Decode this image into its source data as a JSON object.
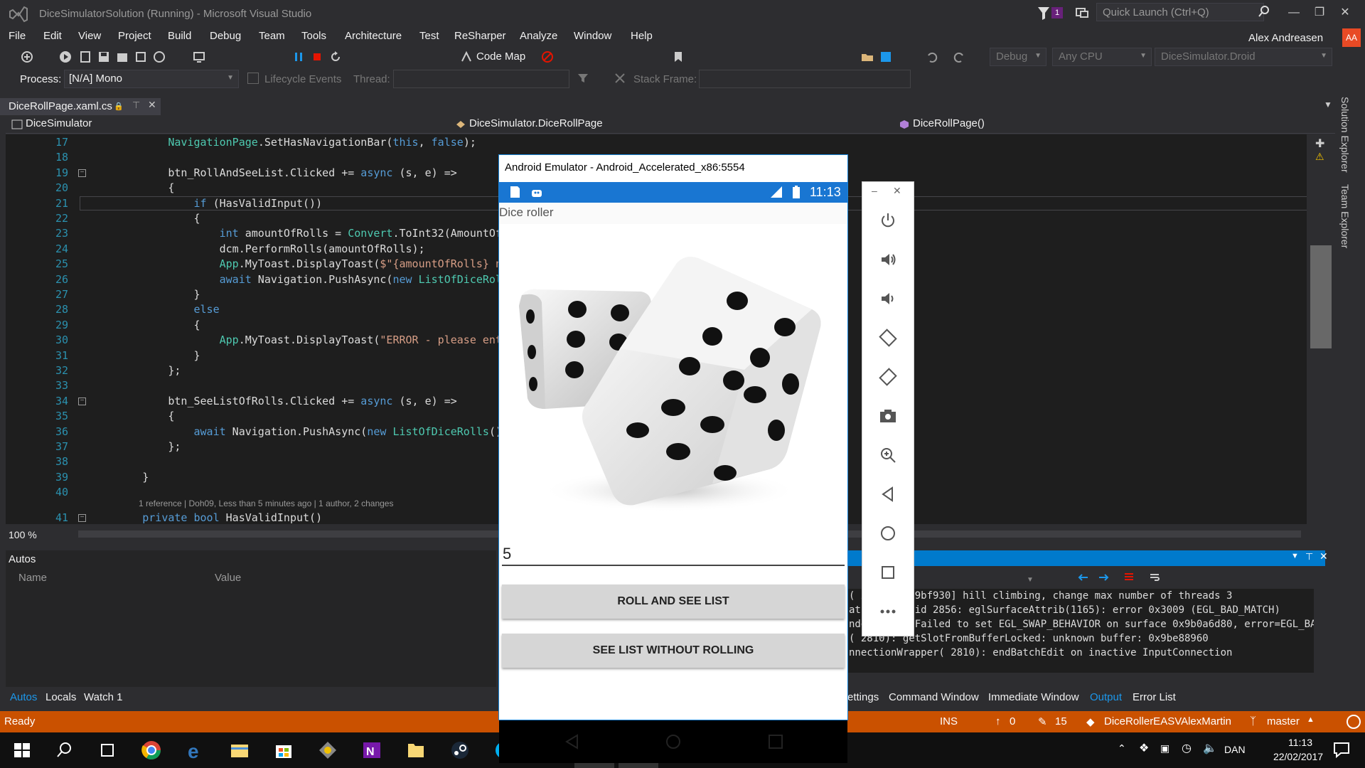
{
  "window": {
    "title": "DiceSimulatorSolution (Running) - Microsoft Visual Studio",
    "notification_count": "1",
    "quick_launch_placeholder": "Quick Launch (Ctrl+Q)",
    "user": "Alex Andreasen",
    "user_initials": "AA"
  },
  "menu": [
    "File",
    "Edit",
    "View",
    "Project",
    "Build",
    "Debug",
    "Team",
    "Tools",
    "Architecture",
    "Test",
    "ReSharper",
    "Analyze",
    "Window",
    "Help"
  ],
  "toolbar": {
    "code_map": "Code Map",
    "config": "Debug",
    "platform": "Any CPU",
    "startup_project": "DiceSimulator.Droid"
  },
  "debug_location": {
    "process_label": "Process:",
    "process_value": "[N/A] Mono",
    "lifecycle_label": "Lifecycle Events",
    "thread_label": "Thread:",
    "stack_frame_label": "Stack Frame:"
  },
  "document_tab": {
    "label": "DiceRollPage.xaml.cs"
  },
  "navbar": {
    "project": "DiceSimulator",
    "type": "DiceSimulator.DiceRollPage",
    "member": "DiceRollPage()"
  },
  "code_lines": [
    {
      "n": "17",
      "text": "            NavigationPage.SetHasNavigationBar(this, false);"
    },
    {
      "n": "18",
      "text": ""
    },
    {
      "n": "19",
      "text": "            btn_RollAndSeeList.Clicked += async (s, e) =>"
    },
    {
      "n": "20",
      "text": "            {"
    },
    {
      "n": "21",
      "text": "                if (HasValidInput())"
    },
    {
      "n": "22",
      "text": "                {"
    },
    {
      "n": "23",
      "text": "                    int amountOfRolls = Convert.ToInt32(AmountOf"
    },
    {
      "n": "24",
      "text": "                    dcm.PerformRolls(amountOfRolls);"
    },
    {
      "n": "25",
      "text": "                    App.MyToast.DisplayToast($\"{amountOfRolls} n"
    },
    {
      "n": "26",
      "text": "                    await Navigation.PushAsync(new ListOfDiceRol"
    },
    {
      "n": "27",
      "text": "                }"
    },
    {
      "n": "28",
      "text": "                else"
    },
    {
      "n": "29",
      "text": "                {"
    },
    {
      "n": "30",
      "text": "                    App.MyToast.DisplayToast(\"ERROR - please ent"
    },
    {
      "n": "31",
      "text": "                }"
    },
    {
      "n": "32",
      "text": "            };"
    },
    {
      "n": "33",
      "text": ""
    },
    {
      "n": "34",
      "text": "            btn_SeeListOfRolls.Clicked += async (s, e) =>"
    },
    {
      "n": "35",
      "text": "            {"
    },
    {
      "n": "36",
      "text": "                await Navigation.PushAsync(new ListOfDiceRolls()"
    },
    {
      "n": "37",
      "text": "            };"
    },
    {
      "n": "38",
      "text": ""
    },
    {
      "n": "39",
      "text": "        }"
    },
    {
      "n": "40",
      "text": ""
    },
    {
      "n": "41",
      "text": "        private bool HasValidInput()"
    }
  ],
  "codelens": "1 reference | Doh09, Less than 5 minutes ago | 1 author, 2 changes",
  "zoom": "100 %",
  "autos": {
    "title": "Autos",
    "col_name": "Name",
    "col_value": "Value",
    "tabs": [
      "Autos",
      "Locals",
      "Watch 1"
    ]
  },
  "output": {
    "lines": [
      "( 2      9a9bf930] hill climbing, change max number of threads 3",
      "at      : tid 2856: eglSurfaceAttrib(1165): error 0x3009 (EGL_BAD_MATCH)",
      "nde     ): Failed to set EGL_SWAP_BEHAVIOR on surface 0x9b0a6d80, error=EGL_BAD",
      "( 2810): getSlotFromBufferLocked: unknown buffer: 0x9be88960",
      "nnectionWrapper( 2810): endBatchEdit on inactive InputConnection"
    ],
    "tabs": [
      "ettings",
      "Command Window",
      "Immediate Window",
      "Output",
      "Error List"
    ]
  },
  "statusbar": {
    "ready": "Ready",
    "ins": "INS",
    "up_count": "0",
    "edit_count": "15",
    "repo": "DiceRollerEASVAlexMartin",
    "branch": "master"
  },
  "taskbar": {
    "lang": "DAN",
    "time": "11:13",
    "date": "22/02/2017"
  },
  "emulator": {
    "title": "Android Emulator - Android_Accelerated_x86:5554",
    "clock": "11:13",
    "app_title": "Dice roller",
    "entry_value": "5",
    "btn_roll": "ROLL AND SEE LIST",
    "btn_see": "SEE LIST WITHOUT ROLLING"
  },
  "colors": {
    "accent": "#007acc",
    "statusbar": "#ca5100",
    "android_blue": "#1976d2"
  }
}
